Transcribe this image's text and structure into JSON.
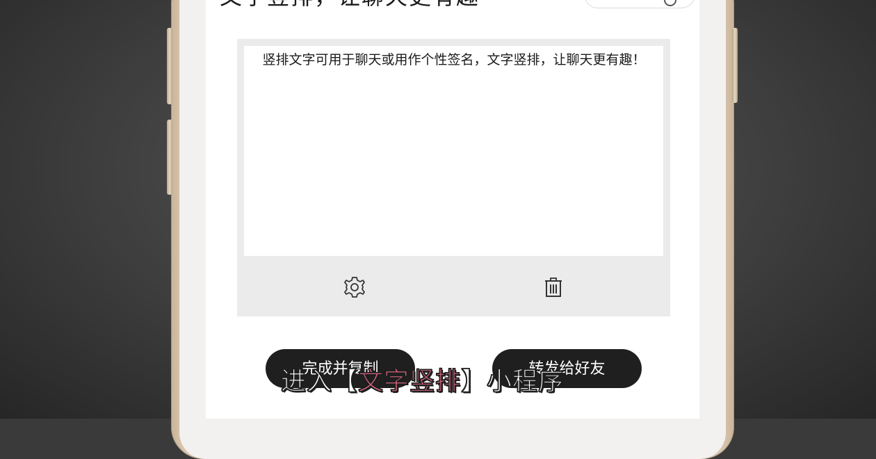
{
  "header": {
    "title_fragment": "文字竖排，让聊天更有趣"
  },
  "editor": {
    "text": "竖排文字可用于聊天或用作个性签名，文字竖排，让聊天更有趣！"
  },
  "toolbar": {
    "settings_icon": "gear-icon",
    "delete_icon": "trash-icon"
  },
  "actions": {
    "complete_copy_label": "完成并复制",
    "share_friend_label": "转发给好友"
  },
  "caption": {
    "prefix": "进入【",
    "highlight": "文字竖排",
    "suffix": "】小程序"
  },
  "colors": {
    "caption_highlight": "#e46a86",
    "button_bg": "#1f1f1f",
    "card_bg": "#ebebeb"
  }
}
